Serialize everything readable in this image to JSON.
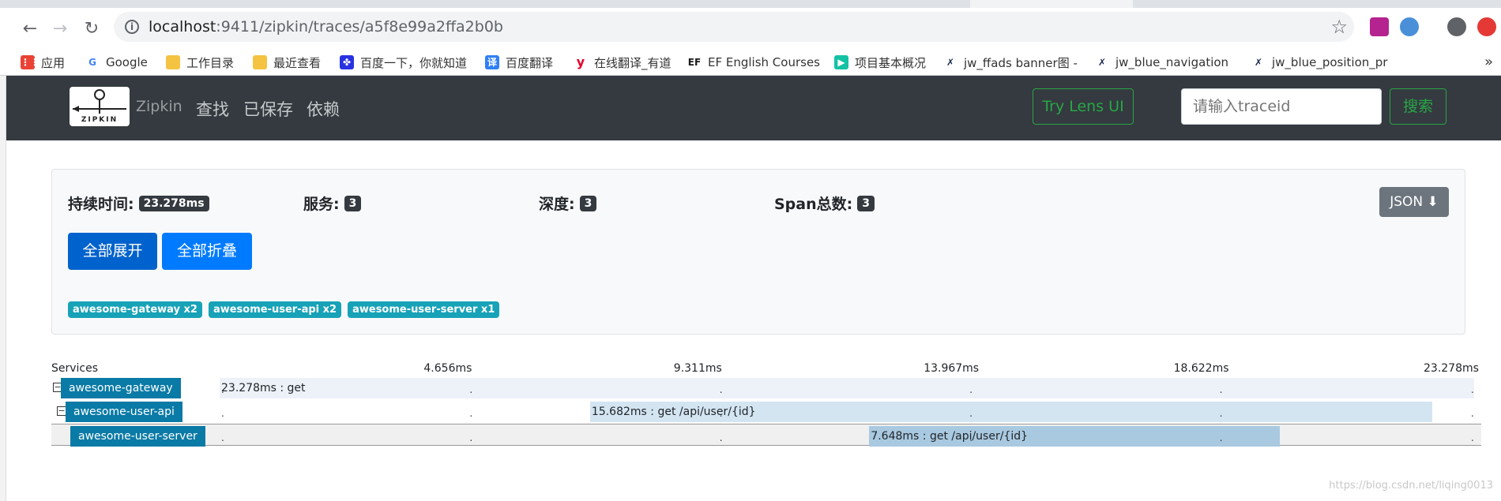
{
  "browser": {
    "url_host": "localhost",
    "url_path": ":9411/zipkin/traces/a5f8e99a2ffa2b0b",
    "bookmarks": [
      {
        "label": "应用",
        "icon": "apps-grid-icon",
        "color": "#4285f4"
      },
      {
        "label": "Google",
        "icon": "google-icon",
        "color": "#4285f4"
      },
      {
        "label": "工作目录",
        "icon": "folder-icon",
        "color": "#f5c342"
      },
      {
        "label": "最近查看",
        "icon": "folder-icon",
        "color": "#f5c342"
      },
      {
        "label": "百度一下，你就知道",
        "icon": "baidu-paw-icon",
        "color": "#2932e1"
      },
      {
        "label": "百度翻译",
        "icon": "translate-icon",
        "color": "#2f7ff5"
      },
      {
        "label": "在线翻译_有道",
        "icon": "youdao-icon",
        "color": "#e4002b"
      },
      {
        "label": "EF English Courses",
        "icon": "ef-icon",
        "color": "#1a1a1a"
      },
      {
        "label": "项目基本概况",
        "icon": "play-icon",
        "color": "#13c2a3"
      },
      {
        "label": "jw_ffads banner图 -",
        "icon": "axure-icon",
        "color": "#1b2a4e"
      },
      {
        "label": "jw_blue_navigation",
        "icon": "axure-icon",
        "color": "#1b2a4e"
      },
      {
        "label": "jw_blue_position_pr",
        "icon": "axure-icon",
        "color": "#1b2a4e"
      }
    ],
    "more": "»"
  },
  "navbar": {
    "logo_text": "ZIPKIN",
    "brand": "Zipkin",
    "links": [
      "查找",
      "已保存",
      "依赖"
    ],
    "lens_button": "Try Lens UI",
    "trace_placeholder": "请输入traceid",
    "search_button": "搜索"
  },
  "summary": {
    "duration_label": "持续时间:",
    "duration_value": "23.278ms",
    "services_label": "服务:",
    "services_value": "3",
    "depth_label": "深度:",
    "depth_value": "3",
    "spans_label": "Span总数:",
    "spans_value": "3",
    "json_button": "JSON",
    "expand_all": "全部展开",
    "collapse_all": "全部折叠",
    "service_badges": [
      "awesome-gateway x2",
      "awesome-user-api x2",
      "awesome-user-server x1"
    ]
  },
  "timeline": {
    "services_header": "Services",
    "ticks": [
      "4.656ms",
      "9.311ms",
      "13.967ms",
      "18.622ms",
      "23.278ms"
    ],
    "total_ms": 23.278,
    "rows": [
      {
        "service": "awesome-gateway",
        "label": "23.278ms : get",
        "start_ms": 0,
        "duration_ms": 23.278,
        "toggle": "−",
        "color": "#edf2f9"
      },
      {
        "service": "awesome-user-api",
        "label": "15.682ms : get /api/user/{id}",
        "start_ms": 6.9,
        "duration_ms": 15.682,
        "toggle": "−",
        "color": "#d4e5f2"
      },
      {
        "service": "awesome-user-server",
        "label": "7.648ms : get /api/user/{id}",
        "start_ms": 12.1,
        "duration_ms": 7.648,
        "toggle": "",
        "color": "#a9c9e0"
      }
    ]
  },
  "watermark": "https://blog.csdn.net/liqing0013"
}
